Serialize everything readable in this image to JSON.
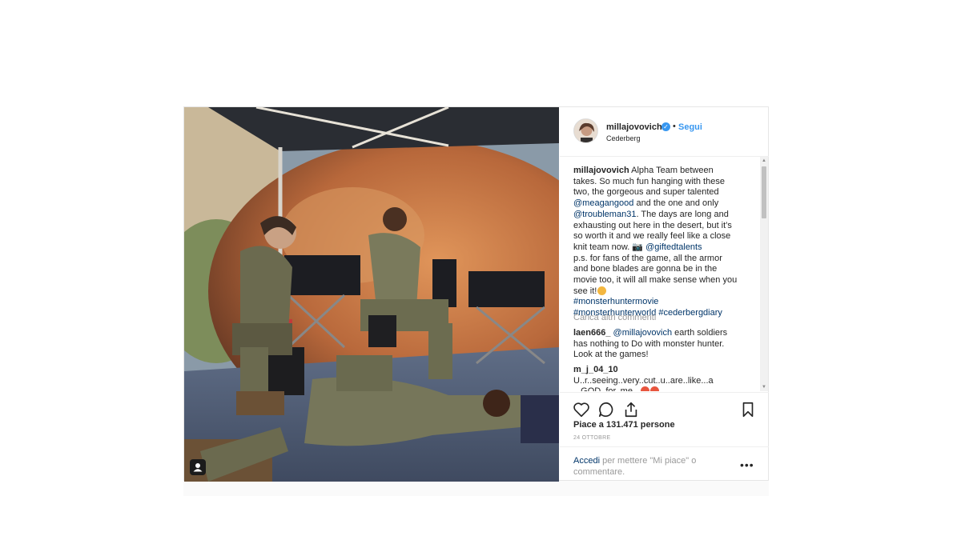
{
  "post": {
    "username": "millajovovich",
    "verified": true,
    "follow_separator": "•",
    "follow_label": "Segui",
    "location": "Cederberg",
    "caption": {
      "username": "millajovovich",
      "text_1": " Alpha Team between takes. So much fun hanging with these two, the gorgeous and super talented ",
      "mention_1": "@meagangood",
      "text_2": " and the one and only ",
      "mention_2": "@troubleman31",
      "text_3": ". The days are long and exhausting out here in the desert, but it’s so worth it and we really feel like a close knit team now. 📷 ",
      "mention_3": "@giftedtalents",
      "text_4": "p.s. for fans of the game, all the armor and bone blades are gonna be in the movie too, it will all make sense when you see it!",
      "hashtag_1": "#monsterhuntermovie",
      "hashtag_2": "#monsterhunterworld",
      "hashtag_3": "#cederbergdiary"
    },
    "load_more_comments": "Carica altri commenti",
    "comments": [
      {
        "username": "laen666_",
        "mention": "@millajovovich",
        "text": " earth soldiers has nothing to Do with monster hunter. Look at the games!"
      },
      {
        "username": "m_j_04_10",
        "text": " U..r..seeing..very..cut..u..are..like...a ...GOD..for..me..."
      }
    ],
    "likes_text": "Piace a 131.471 persone",
    "date": "24 OTTOBRE",
    "login_link": "Accedi",
    "login_text": " per mettere \"Mi piace\" o commentare.",
    "options_label": "•••"
  },
  "colors": {
    "accent": "#3897f0",
    "link": "#003569",
    "muted": "#999999",
    "border": "#efefef"
  },
  "icons": {
    "like": "heart-outline-icon",
    "comment": "speech-bubble-icon",
    "share": "share-icon",
    "save": "bookmark-icon",
    "user_tag": "user-tag-icon",
    "verified": "verified-badge-icon"
  }
}
